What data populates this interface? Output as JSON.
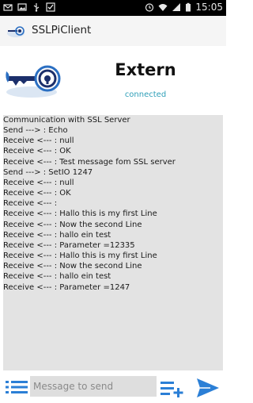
{
  "status_bar": {
    "time": "15:05",
    "icons": [
      "mail-icon",
      "image-icon",
      "usb-icon",
      "check-icon",
      "alarm-icon",
      "wifi-icon",
      "signal-icon",
      "battery-icon"
    ]
  },
  "app_bar": {
    "title": "SSLPiClient",
    "logo_icon": "key-lock-icon"
  },
  "header": {
    "name": "Extern",
    "status": "connected",
    "status_color": "#2f9fb8",
    "logo_icon": "key-lock-icon"
  },
  "console": {
    "lines": [
      "Communication with SSL Server",
      "Send ---> : Echo",
      "Receive <--- : null",
      "Receive <--- : OK",
      "Receive <--- : Test message fom SSL server",
      "Send ---> : SetIO 1247",
      "Receive <--- : null",
      "Receive <--- : OK",
      "Receive <--- :",
      "Receive <--- : Hallo this is my first Line",
      "Receive <--- : Now the second Line",
      "Receive <--- : hallo ein test",
      "Receive <--- : Parameter =12335",
      "Receive <--- : Hallo this is my first Line",
      "Receive <--- : Now the second Line",
      "Receive <--- : hallo ein test",
      "Receive <--- : Parameter =1247"
    ]
  },
  "bottom_bar": {
    "menu_icon": "list-icon",
    "input_value": "",
    "input_placeholder": "Message to send",
    "add_icon": "add-list-icon",
    "send_icon": "send-icon",
    "accent_color": "#2b7fd6"
  }
}
